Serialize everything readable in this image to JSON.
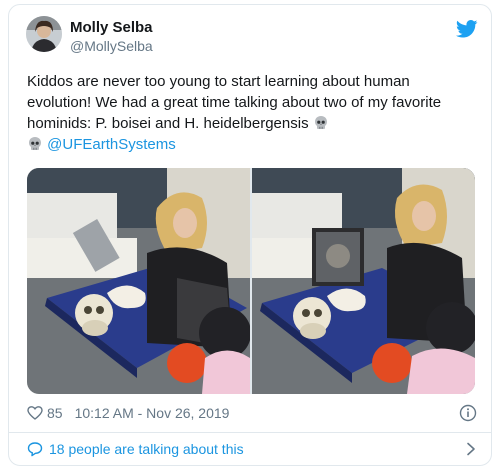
{
  "author": {
    "name": "Molly Selba",
    "handle": "@MollySelba"
  },
  "tweet": {
    "text_line_1": "Kiddos are never too young to start learning about human",
    "text_line_2": "evolution! We had a great time talking about two of my favorite",
    "text_line_3": "hominids: P. boisei and H. heidelbergensis",
    "mention": "@UFEarthSystems",
    "emoji_1": "skull-emoji",
    "emoji_2": "skull-emoji"
  },
  "media": {
    "photo_count": 2
  },
  "meta": {
    "like_count": "85",
    "timestamp": "10:12 AM - Nov 26, 2019"
  },
  "conversation": {
    "label": "18 people are talking about this"
  },
  "colors": {
    "accent": "#1b95e0",
    "twitter_blue": "#1da1f2",
    "muted_text": "#657786",
    "border": "#e1e8ed",
    "heart": "#657786"
  },
  "icons": {
    "brand": "twitter-bird-icon",
    "like": "heart-icon",
    "info": "info-icon",
    "reply": "speech-bubble-icon",
    "more": "chevron-right-icon"
  }
}
